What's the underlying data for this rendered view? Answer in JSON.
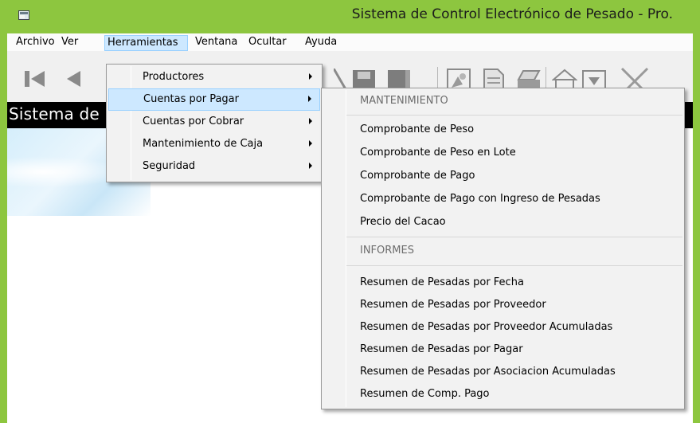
{
  "window": {
    "title": "Sistema de Control Electrónico de Pesado - Pro.",
    "accent_color": "#8dc63f"
  },
  "menubar": {
    "items": [
      "Archivo",
      "Ver",
      "Herramientas",
      "Ventana",
      "Ocultar",
      "Ayuda"
    ],
    "active": "Herramientas"
  },
  "toolbar": {
    "icons": [
      "first-record-icon",
      "previous-record-icon",
      "edit-icon",
      "save-icon",
      "delete-icon",
      "search-icon",
      "document-icon",
      "print-icon",
      "home-icon",
      "close-icon"
    ]
  },
  "header": {
    "text": "Sistema de"
  },
  "herramientas_menu": {
    "items": [
      {
        "label": "Productores",
        "has_submenu": true
      },
      {
        "label": "Cuentas por Pagar",
        "has_submenu": true,
        "highlighted": true
      },
      {
        "label": "Cuentas por Cobrar",
        "has_submenu": true
      },
      {
        "label": "Mantenimiento de Caja",
        "has_submenu": true
      },
      {
        "label": "Seguridad",
        "has_submenu": true
      }
    ]
  },
  "cuentas_submenu": {
    "section1": "MANTENIMIENTO",
    "items1": [
      "Comprobante de Peso",
      "Comprobante de Peso en Lote",
      "Comprobante de Pago",
      "Comprobante de Pago con Ingreso de Pesadas",
      "Precio del Cacao"
    ],
    "section2": "INFORMES",
    "items2": [
      "Resumen de Pesadas por Fecha",
      "Resumen de Pesadas por Proveedor",
      "Resumen de Pesadas por Proveedor Acumuladas",
      "Resumen de Pesadas por Pagar",
      "Resumen de Pesadas por Asociacion Acumuladas",
      "Resumen de Comp. Pago"
    ]
  }
}
